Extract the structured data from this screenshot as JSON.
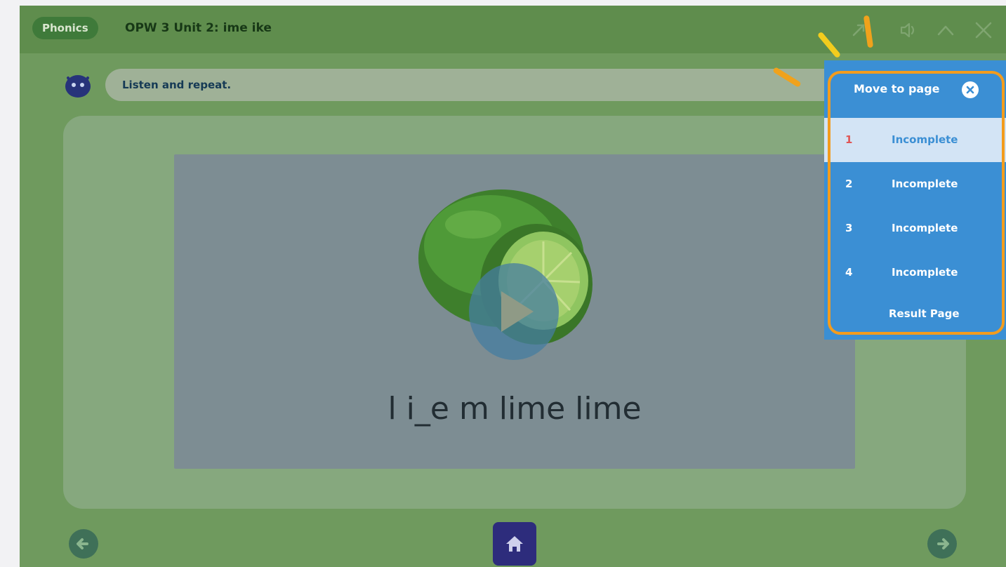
{
  "header": {
    "subject_badge": "Phonics",
    "title": "OPW 3 Unit 2: ime ike",
    "icons": [
      "expand-icon",
      "speaker-icon",
      "collapse-up-icon",
      "close-icon"
    ]
  },
  "instruction": {
    "text": "Listen and repeat."
  },
  "content": {
    "word_text": "l i_e m lime lime",
    "image_subject": "lime"
  },
  "navigation": {
    "prev_icon": "arrow-left-icon",
    "home_icon": "home-icon",
    "next_icon": "arrow-right-icon"
  },
  "page_menu": {
    "title": "Move to page",
    "pages": [
      {
        "number": "1",
        "status": "Incomplete",
        "active": true
      },
      {
        "number": "2",
        "status": "Incomplete",
        "active": false
      },
      {
        "number": "3",
        "status": "Incomplete",
        "active": false
      },
      {
        "number": "4",
        "status": "Incomplete",
        "active": false
      }
    ],
    "result_label": "Result Page"
  },
  "colors": {
    "header": "#5f8d4d",
    "popup": "#3b8fd4",
    "highlight": "#f39c1d",
    "active_row": "#d3e4f5",
    "active_number": "#e05656",
    "home_button": "#2d2c7c"
  }
}
